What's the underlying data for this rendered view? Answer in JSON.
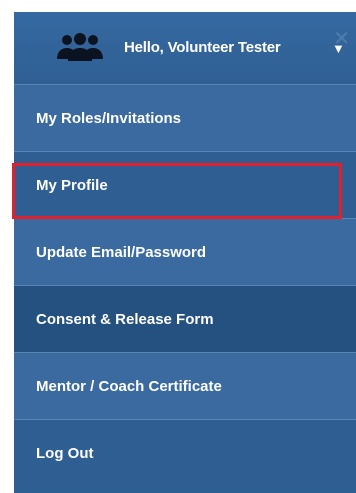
{
  "header": {
    "greeting": "Hello, Volunteer Tester",
    "caret": "▼",
    "icon": "users-icon"
  },
  "menu": {
    "items": [
      {
        "label": "My Roles/Invitations"
      },
      {
        "label": "My Profile"
      },
      {
        "label": "Update Email/Password"
      },
      {
        "label": "Consent & Release Form"
      },
      {
        "label": "Mentor / Coach Certificate"
      },
      {
        "label": "Log Out"
      }
    ],
    "highlighted_item": "My Profile",
    "highlight_color": "#e0202a"
  },
  "colors": {
    "menu_bg": "#2e5f93",
    "text": "#ffffff"
  }
}
